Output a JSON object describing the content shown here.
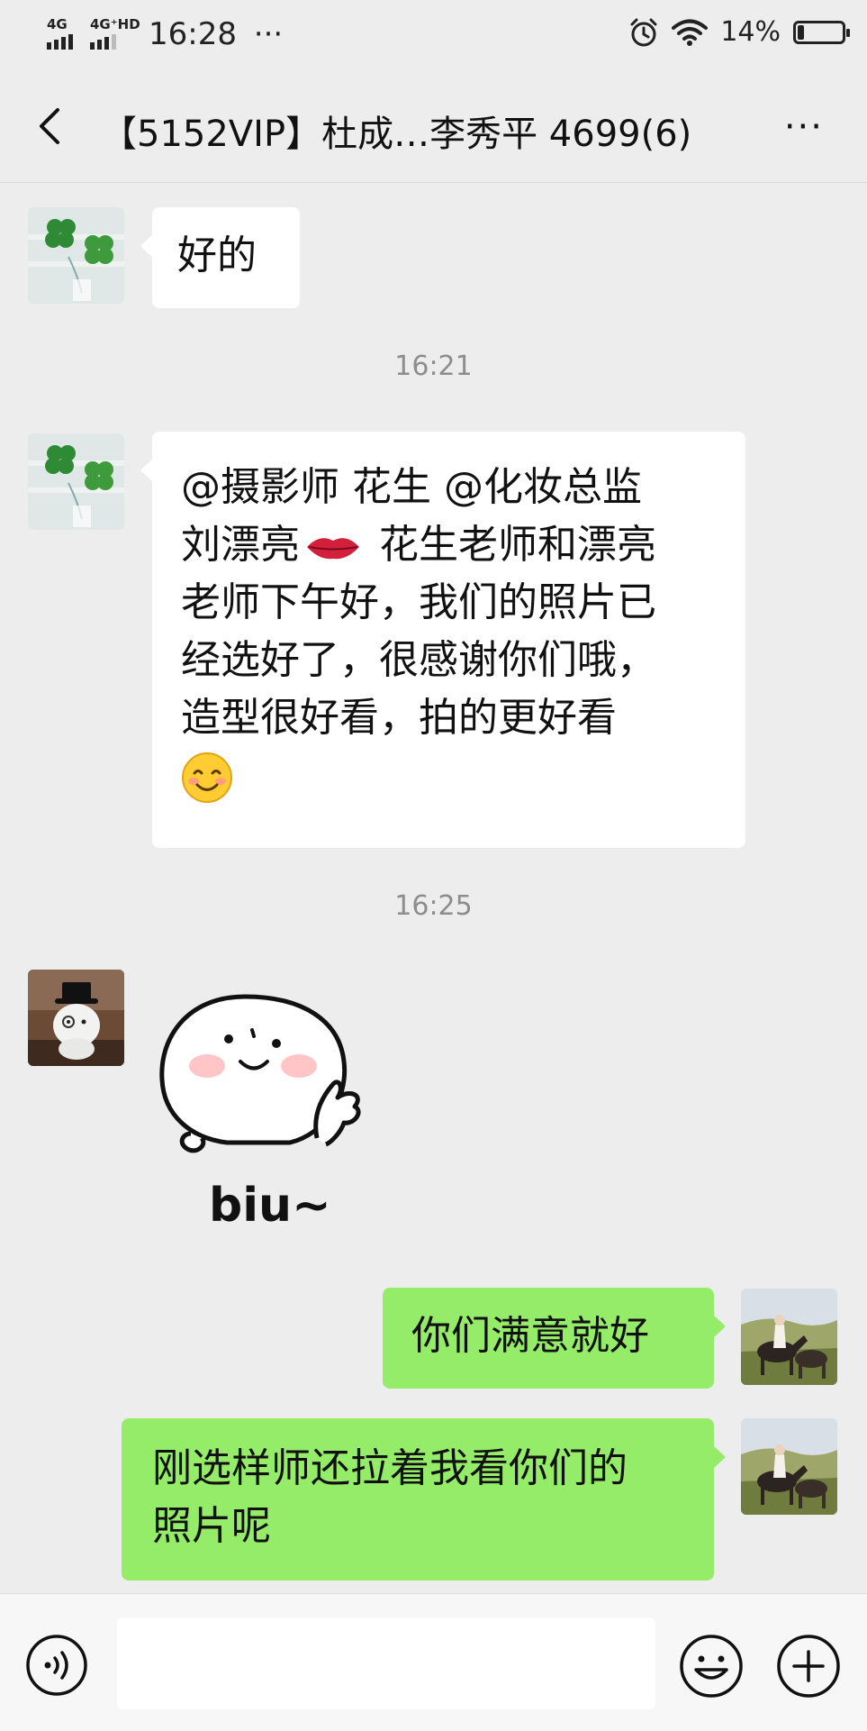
{
  "status_bar": {
    "net1": "4G",
    "net2": "4G⁺HD",
    "time": "16:28",
    "dots": "···",
    "battery_text": "14%",
    "battery_level": 0.14
  },
  "nav": {
    "title": "【5152VIP】杜成…李秀平  4699(6)",
    "more": "···"
  },
  "messages": {
    "m1": {
      "text": "好的"
    },
    "ts1": "16:21",
    "m2": {
      "part1": "@摄影师  花生  @化妆总监",
      "part2a": "刘漂亮",
      "part2b": "  花生老师和漂亮",
      "part3": "老师下午好，我们的照片已",
      "part4": "经选好了，很感谢你们哦，",
      "part5": "造型很好看，拍的更好看"
    },
    "ts2": "16:25",
    "sticker": {
      "caption": "biu~"
    },
    "m3": {
      "text": "你们满意就好"
    },
    "m4": {
      "line1": "刚选样师还拉着我看你们的",
      "line2": "照片呢"
    }
  },
  "colors": {
    "background": "#ededed",
    "bubble_incoming": "#ffffff",
    "bubble_outgoing": "#95ec69",
    "timestamp": "#8d8d8d"
  },
  "icons": [
    "back-arrow-icon",
    "more-icon",
    "voice-icon",
    "emoji-icon",
    "plus-icon",
    "alarm-icon",
    "wifi-icon",
    "battery-icon",
    "lips-emoji-icon",
    "smile-emoji-icon"
  ]
}
